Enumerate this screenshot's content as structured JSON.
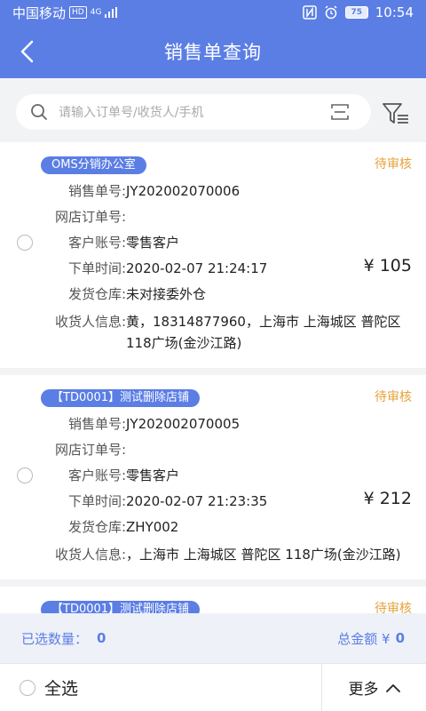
{
  "status_bar": {
    "carrier": "中国移动",
    "hd_badge": "HD",
    "network": "4G",
    "battery": "75",
    "time": "10:54"
  },
  "header": {
    "title": "销售单查询"
  },
  "search": {
    "placeholder": "请输入订单号/收货人/手机"
  },
  "labels": {
    "order_no": "销售单号:",
    "shop_order_no": "网店订单号:",
    "customer_account": "客户账号:",
    "order_time": "下单时间:",
    "warehouse": "发货仓库:",
    "receiver": "收货人信息:"
  },
  "orders": [
    {
      "store": "OMS分销办公室",
      "status": "待审核",
      "order_no": "JY202002070006",
      "shop_order_no": "",
      "customer_account": "零售客户",
      "order_time": "2020-02-07 21:24:17",
      "amount": "¥ 105",
      "warehouse": "未对接委外仓",
      "receiver": "黄，18314877960，上海市 上海城区 普陀区 118广场(金沙江路)"
    },
    {
      "store": "【TD0001】测试删除店铺",
      "status": "待审核",
      "order_no": "JY202002070005",
      "shop_order_no": "",
      "customer_account": "零售客户",
      "order_time": "2020-02-07 21:23:35",
      "amount": "¥ 212",
      "warehouse": "ZHY002",
      "receiver": "，上海市 上海城区 普陀区 118广场(金沙江路)"
    },
    {
      "store": "【TD0001】测试删除店铺",
      "status": "待审核"
    }
  ],
  "summary": {
    "selected_label": "已选数量：",
    "selected_count": "0",
    "total_label": "总金额 ¥",
    "total_amount": "0"
  },
  "bottom": {
    "select_all": "全选",
    "more": "更多"
  },
  "colors": {
    "primary": "#5b7ee5",
    "pending": "#e6a23c"
  }
}
